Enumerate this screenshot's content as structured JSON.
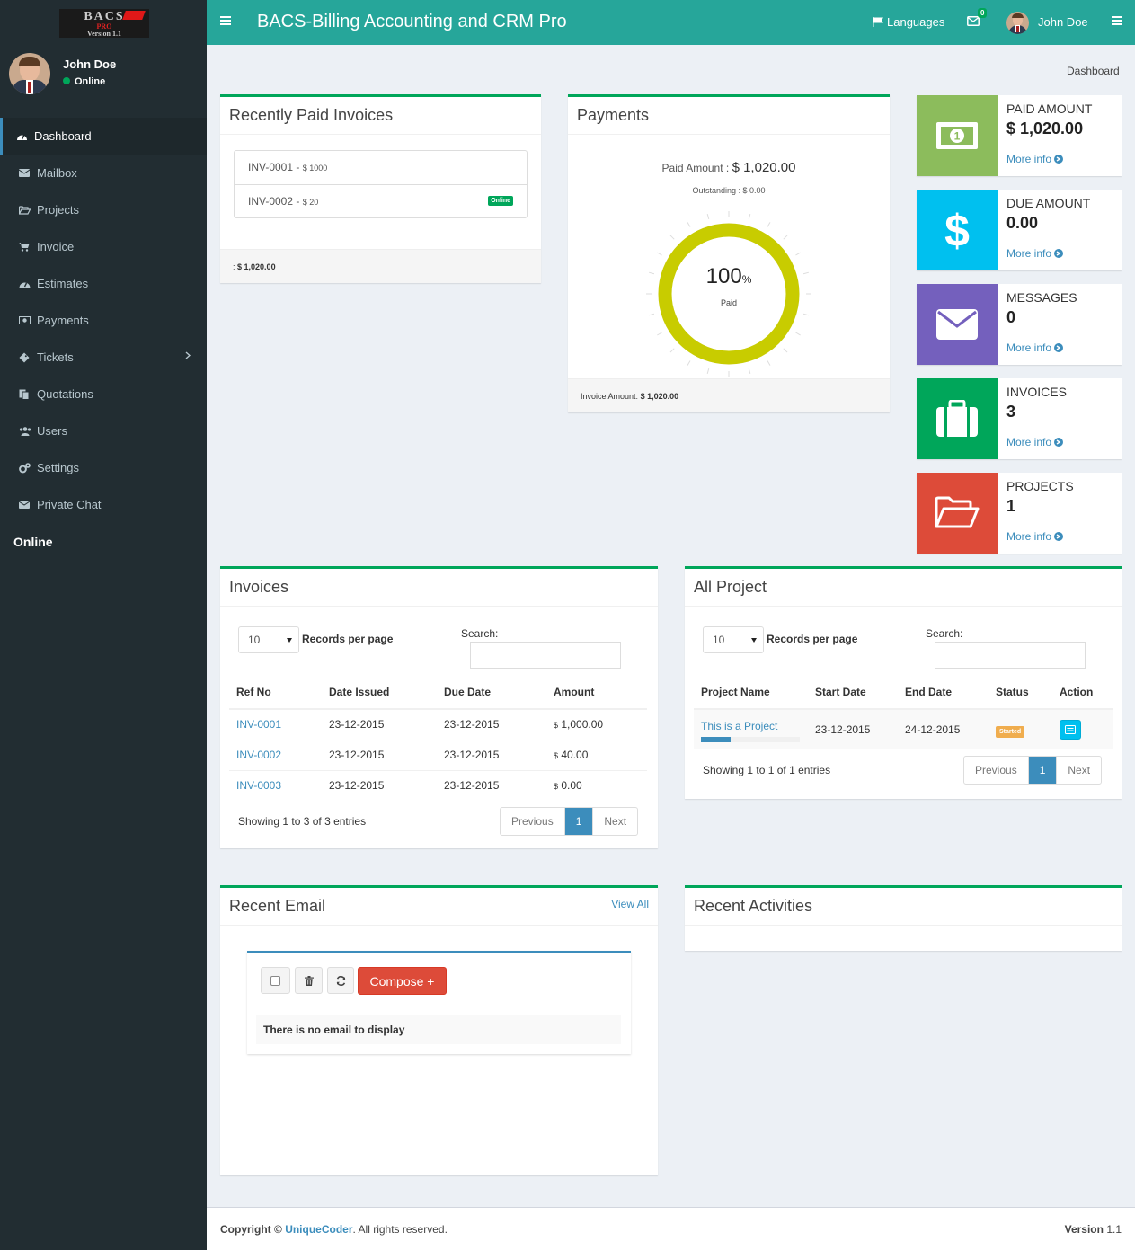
{
  "brand": {
    "logo_line1": "BACS",
    "logo_line2": "PRO",
    "logo_line3": "Version 1.1"
  },
  "user": {
    "name": "John Doe",
    "status": "Online"
  },
  "sidebar": {
    "items": [
      {
        "label": "Dashboard",
        "icon": "dashboard-icon"
      },
      {
        "label": "Mailbox",
        "icon": "envelope-icon"
      },
      {
        "label": "Projects",
        "icon": "folder-open-icon"
      },
      {
        "label": "Invoice",
        "icon": "cart-icon"
      },
      {
        "label": "Estimates",
        "icon": "tachometer-icon"
      },
      {
        "label": "Payments",
        "icon": "money-icon"
      },
      {
        "label": "Tickets",
        "icon": "ticket-icon"
      },
      {
        "label": "Quotations",
        "icon": "copy-icon"
      },
      {
        "label": "Users",
        "icon": "users-icon"
      },
      {
        "label": "Settings",
        "icon": "cogs-icon"
      },
      {
        "label": "Private Chat",
        "icon": "envelope-icon"
      }
    ],
    "online_heading": "Online"
  },
  "header": {
    "title": "BACS-Billing Accounting and CRM Pro",
    "languages": "Languages",
    "mail_count": "0",
    "user_name": "John Doe"
  },
  "breadcrumb": "Dashboard",
  "recent_paid": {
    "title": "Recently Paid Invoices",
    "items": [
      {
        "ref": "INV-0001",
        "amount": "$ 1000",
        "label": ""
      },
      {
        "ref": "INV-0002",
        "amount": "$ 20",
        "label": "Online"
      }
    ],
    "footer_prefix": ":",
    "footer_total": "$ 1,020.00"
  },
  "payments": {
    "title": "Payments",
    "paid_label": "Paid Amount :",
    "paid_value": "$ 1,020.00",
    "outstanding": "Outstanding : $ 0.00",
    "percent": "100",
    "percent_sign": "%",
    "percent_label": "Paid",
    "percent_value": 100,
    "footer_label": "Invoice Amount:",
    "footer_value": "$ 1,020.00",
    "gauge_color": "#c8cc00"
  },
  "info_boxes": [
    {
      "label": "PAID AMOUNT",
      "value": "$ 1,020.00",
      "more": "More info",
      "color": "#8cbc5c",
      "icon": "money-icon"
    },
    {
      "label": "DUE AMOUNT",
      "value": "0.00",
      "more": "More info",
      "color": "#00c0ef",
      "icon": "dollar-icon"
    },
    {
      "label": "MESSAGES",
      "value": "0",
      "more": "More info",
      "color": "#7460bd",
      "icon": "envelope-icon"
    },
    {
      "label": "INVOICES",
      "value": "3",
      "more": "More info",
      "color": "#00a65a",
      "icon": "briefcase-icon"
    },
    {
      "label": "PROJECTS",
      "value": "1",
      "more": "More info",
      "color": "#dd4b39",
      "icon": "folder-open-icon"
    }
  ],
  "invoices": {
    "title": "Invoices",
    "per_page": "10",
    "records_label": "Records per page",
    "search_label": "Search:",
    "columns": [
      "Ref No",
      "Date Issued",
      "Due Date",
      "Amount"
    ],
    "rows": [
      {
        "ref": "INV-0001",
        "issued": "23-12-2015",
        "due": "23-12-2015",
        "cur": "$",
        "amount": "1,000.00"
      },
      {
        "ref": "INV-0002",
        "issued": "23-12-2015",
        "due": "23-12-2015",
        "cur": "$",
        "amount": "40.00"
      },
      {
        "ref": "INV-0003",
        "issued": "23-12-2015",
        "due": "23-12-2015",
        "cur": "$",
        "amount": "0.00"
      }
    ],
    "showing": "Showing 1 to 3 of 3 entries",
    "prev": "Previous",
    "page": "1",
    "next": "Next"
  },
  "projects": {
    "title": "All Project",
    "per_page": "10",
    "records_label": "Records per page",
    "search_label": "Search:",
    "columns": [
      "Project Name",
      "Start Date",
      "End Date",
      "Status",
      "Action"
    ],
    "rows": [
      {
        "name": "This is a Project",
        "start": "23-12-2015",
        "end": "24-12-2015",
        "status": "Started",
        "progress": 0.3
      }
    ],
    "showing": "Showing 1 to 1 of 1 entries",
    "prev": "Previous",
    "page": "1",
    "next": "Next"
  },
  "recent_email": {
    "title": "Recent Email",
    "view_all": "View All",
    "compose": "Compose +",
    "empty": "There is no email to display"
  },
  "recent_activities": {
    "title": "Recent Activities"
  },
  "footer": {
    "copyright": "Copyright ©",
    "company": "UniqueCoder",
    "rights": ". All rights reserved.",
    "version_label": "Version",
    "version": "1.1"
  }
}
